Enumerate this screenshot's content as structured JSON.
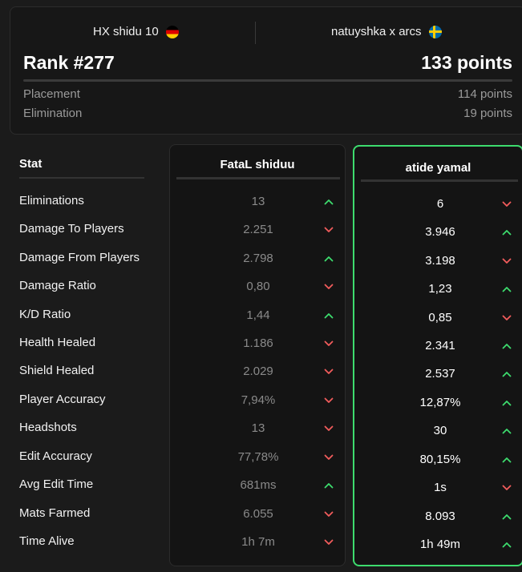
{
  "match": {
    "team_left": "HX shidu 10",
    "team_right": "natuyshka x arcs",
    "rank": "Rank #277",
    "total_points": "133 points",
    "placement_label": "Placement",
    "placement_points": "114 points",
    "elimination_label": "Elimination",
    "elimination_points": "19 points"
  },
  "stat_header": "Stat",
  "players": [
    "FataL shiduu",
    "atide yamal"
  ],
  "colors": {
    "up": "#3ddc6e",
    "down": "#f25c5c",
    "highlight_border": "#3ddc6e"
  },
  "rows": [
    {
      "label": "Eliminations",
      "p1": "13",
      "p1_trend": "up",
      "p2": "6",
      "p2_trend": "down"
    },
    {
      "label": "Damage To Players",
      "p1": "2.251",
      "p1_trend": "down",
      "p2": "3.946",
      "p2_trend": "up"
    },
    {
      "label": "Damage From Players",
      "p1": "2.798",
      "p1_trend": "up",
      "p2": "3.198",
      "p2_trend": "down"
    },
    {
      "label": "Damage Ratio",
      "p1": "0,80",
      "p1_trend": "down",
      "p2": "1,23",
      "p2_trend": "up"
    },
    {
      "label": "K/D Ratio",
      "p1": "1,44",
      "p1_trend": "up",
      "p2": "0,85",
      "p2_trend": "down"
    },
    {
      "label": "Health Healed",
      "p1": "1.186",
      "p1_trend": "down",
      "p2": "2.341",
      "p2_trend": "up"
    },
    {
      "label": "Shield Healed",
      "p1": "2.029",
      "p1_trend": "down",
      "p2": "2.537",
      "p2_trend": "up"
    },
    {
      "label": "Player Accuracy",
      "p1": "7,94%",
      "p1_trend": "down",
      "p2": "12,87%",
      "p2_trend": "up"
    },
    {
      "label": "Headshots",
      "p1": "13",
      "p1_trend": "down",
      "p2": "30",
      "p2_trend": "up"
    },
    {
      "label": "Edit Accuracy",
      "p1": "77,78%",
      "p1_trend": "down",
      "p2": "80,15%",
      "p2_trend": "up"
    },
    {
      "label": "Avg Edit Time",
      "p1": "681ms",
      "p1_trend": "up",
      "p2": "1s",
      "p2_trend": "down"
    },
    {
      "label": "Mats Farmed",
      "p1": "6.055",
      "p1_trend": "down",
      "p2": "8.093",
      "p2_trend": "up"
    },
    {
      "label": "Time Alive",
      "p1": "1h 7m",
      "p1_trend": "down",
      "p2": "1h 49m",
      "p2_trend": "up"
    }
  ]
}
